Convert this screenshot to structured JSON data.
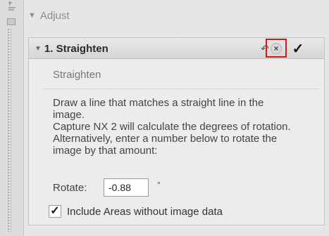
{
  "sidebar": {
    "top_icon": "arrange-icon",
    "mini_icon": "panel-icon"
  },
  "adjust": {
    "label": "Adjust",
    "collapse_glyph": "▼"
  },
  "step": {
    "title": "1. Straighten",
    "collapse_glyph": "▼",
    "reset_glyph": "↶",
    "close_glyph": "×",
    "apply_glyph": "✓",
    "highlight_color": "#d11a1a"
  },
  "content": {
    "subtitle": "Straighten",
    "description": {
      "line1": "Draw a line that matches a straight line in the",
      "line2": "image.",
      "line3": "Capture NX 2 will calculate the degrees of rotation.",
      "line4": "Alternatively, enter a number below to rotate the",
      "line5": "image by that amount:"
    },
    "rotate": {
      "label": "Rotate:",
      "value": "-0.88",
      "unit": "°"
    },
    "include_areas": {
      "label": "Include Areas without image data",
      "checked": true,
      "check_glyph": "✓"
    }
  }
}
